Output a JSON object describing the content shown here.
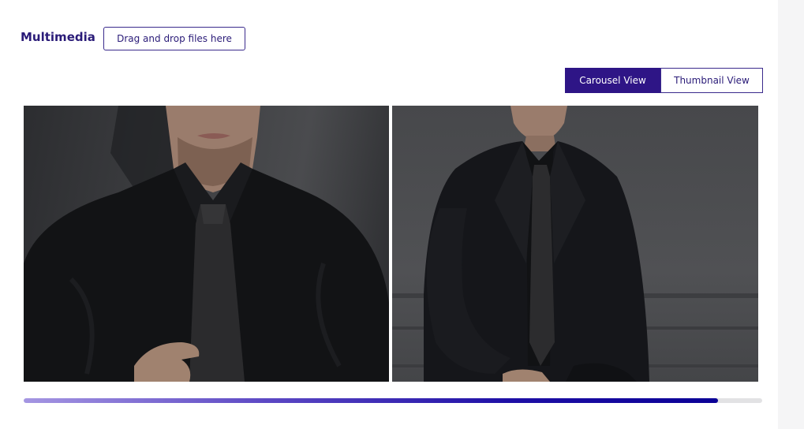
{
  "multimedia": {
    "title": "Multimedia",
    "drop_label": "Drag and drop files here"
  },
  "view_toggle": {
    "options": [
      {
        "label": "Carousel View",
        "active": true
      },
      {
        "label": "Thumbnail View",
        "active": false
      }
    ]
  },
  "carousel": {
    "slides": [
      {
        "icon": "photo-man-black-shirt-tie"
      },
      {
        "icon": "photo-man-black-suit-seated"
      }
    ],
    "scroll_progress": 0.94
  },
  "colors": {
    "accent": "#2e1586",
    "text_accent": "#2a1b78",
    "progress_end": "#0a0096",
    "progress_start": "#a596e2"
  }
}
